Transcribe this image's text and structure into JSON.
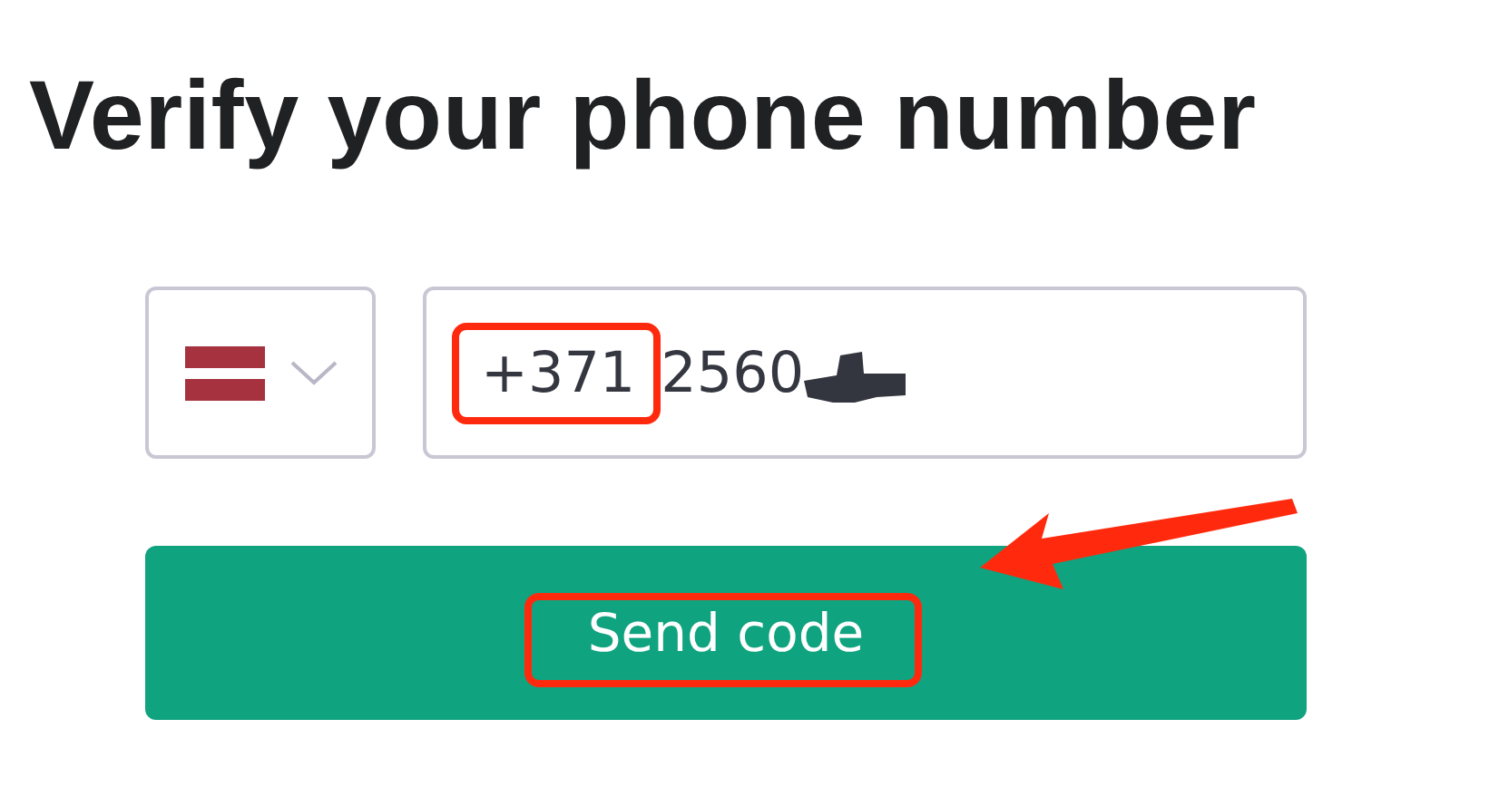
{
  "title": "Verify your phone number",
  "phone": {
    "country_code": "+371",
    "number": "2560",
    "country_code_highlighted": true,
    "number_redacted": true
  },
  "submit_button": {
    "label": "Send code",
    "highlighted": true,
    "pointed_at": true
  }
}
